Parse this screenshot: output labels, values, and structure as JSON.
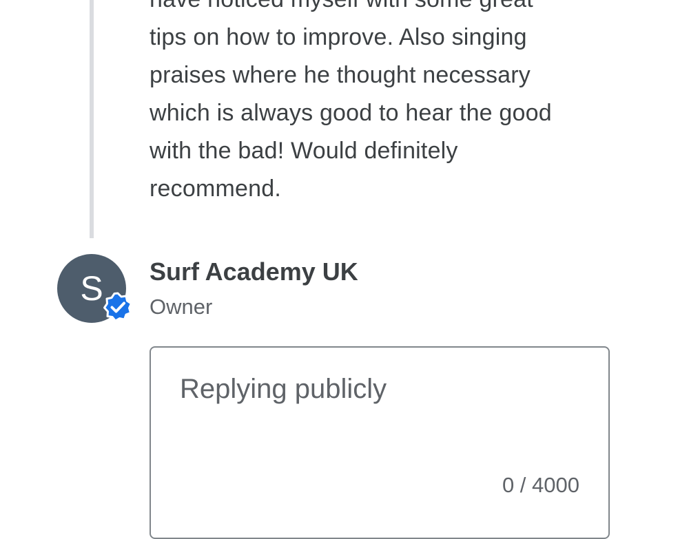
{
  "review": {
    "text_lines": [
      "have noticed myself with some great",
      "tips on how to improve. Also singing",
      "praises where he thought necessary",
      "which is always good to hear the good",
      "with the bad! Would definitely",
      "recommend."
    ]
  },
  "owner": {
    "avatar_initial": "S",
    "avatar_color": "#4e5d6c",
    "badge_icon": "verified-check-icon",
    "badge_color": "#1a73e8",
    "name": "Surf Academy UK",
    "role": "Owner"
  },
  "reply": {
    "placeholder": "Replying publicly",
    "value": "",
    "counter": "0 / 4000"
  }
}
